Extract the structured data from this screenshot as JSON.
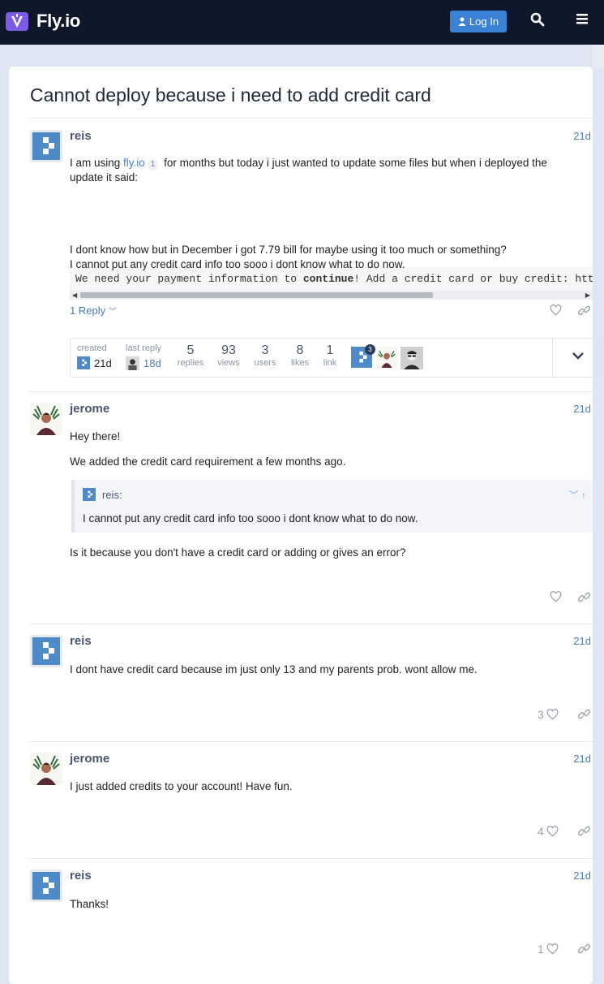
{
  "header": {
    "brand": "Fly.io",
    "login_label": "Log In",
    "colors": {
      "background": "#0f172a",
      "accent": "#3b82d6",
      "logo": "#8b5cf6"
    }
  },
  "topic": {
    "title": "Cannot deploy because i need to add credit card"
  },
  "posts": [
    {
      "username": "reis",
      "date": "21d",
      "para1_before": "I am using ",
      "para1_link": "fly.io",
      "para1_link_count": "1",
      "para1_after": " for months but today i just wanted to update some files but when i deployed the update it said:",
      "code_before": "We need your payment information to ",
      "code_bold": "continue",
      "code_after": "! Add a credit card or buy credit: htt",
      "para2_line1": "I dont know how but in December i got 7.79 bill for maybe using it too much or something?",
      "para2_line2": "I cannot put any credit card info too sooo i dont know what to do now.",
      "replies_label": "1 Reply"
    },
    {
      "username": "jerome",
      "date": "21d",
      "para1": "Hey there!",
      "para2": "We added the credit card requirement a few months ago.",
      "quote_user": "reis:",
      "quote_text": "I cannot put any credit card info too sooo i dont know what to do now.",
      "para3": "Is it because you don't have a credit card or adding or gives an error?"
    },
    {
      "username": "reis",
      "date": "21d",
      "text": "I dont have credit card because im just only 13 and my parents prob. wont allow me.",
      "likes": "3"
    },
    {
      "username": "jerome",
      "date": "21d",
      "text": "I just added credits to your account! Have fun.",
      "likes": "4"
    },
    {
      "username": "reis",
      "date": "21d",
      "text": "Thanks!",
      "likes": "1"
    }
  ],
  "topic_map": {
    "created_label": "created",
    "created_value": "21d",
    "last_reply_label": "last reply",
    "last_reply_value": "18d",
    "stats": [
      {
        "num": "5",
        "label": "replies"
      },
      {
        "num": "93",
        "label": "views"
      },
      {
        "num": "3",
        "label": "users"
      },
      {
        "num": "8",
        "label": "likes"
      },
      {
        "num": "1",
        "label": "link"
      }
    ],
    "top_poster_count": "3"
  }
}
